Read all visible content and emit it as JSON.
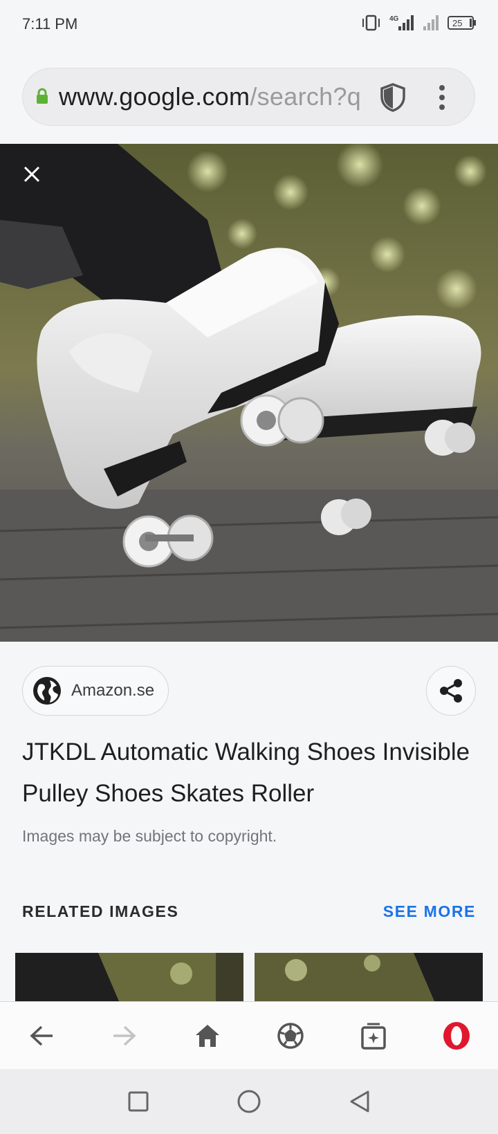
{
  "status_bar": {
    "time": "7:11 PM",
    "network": "4G",
    "battery": "25"
  },
  "url_bar": {
    "host": "www.google.com",
    "path": "/search?q",
    "icons": [
      "lock-icon",
      "shield-icon",
      "more-vert-icon"
    ]
  },
  "image_viewer": {
    "image_description": "white roller skate sneakers",
    "close_icon": "close-icon"
  },
  "details": {
    "source": "Amazon.se",
    "title": "JTKDL Automatic Walking Shoes Invisible Pulley Shoes Skates Roller",
    "copyright_notice": "Images may be subject to copyright.",
    "related_label": "RELATED IMAGES",
    "see_more_label": "SEE MORE"
  },
  "toolbar": {
    "items": [
      "back-arrow-icon",
      "forward-arrow-icon",
      "home-icon",
      "speed-dial-icon",
      "tabs-icon",
      "opera-menu-icon"
    ]
  },
  "android_nav": {
    "items": [
      "recents-square-icon",
      "home-circle-icon",
      "back-triangle-icon"
    ]
  },
  "colors": {
    "accent_blue": "#1a73e8",
    "lock_green": "#5fb136",
    "opera_red": "#e0182d",
    "background": "#f5f6f8"
  }
}
